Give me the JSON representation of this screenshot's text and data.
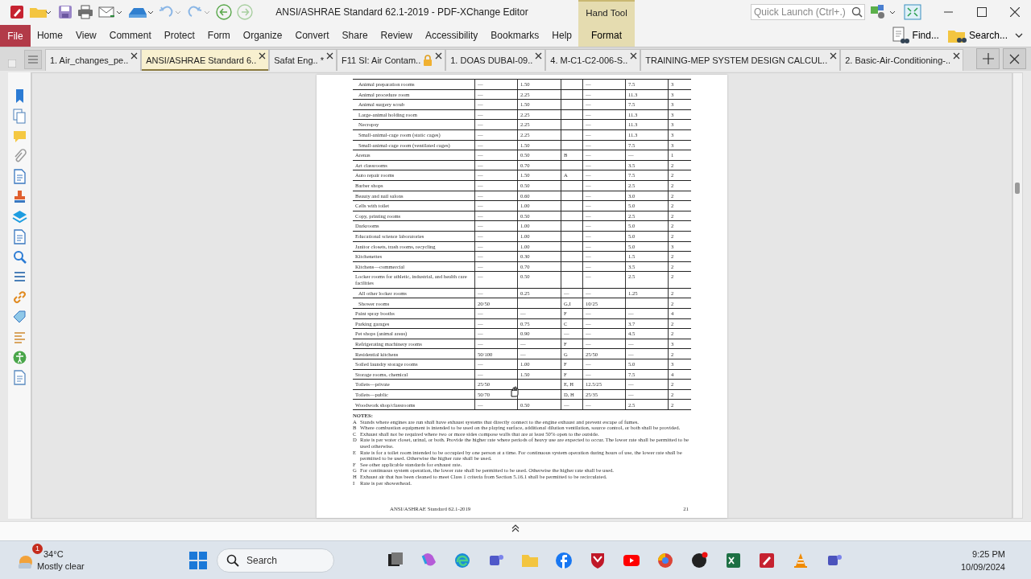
{
  "window": {
    "title": "ANSI/ASHRAE Standard 62.1-2019 - PDF-XChange Editor"
  },
  "quick_launch": {
    "placeholder": "Quick Launch (Ctrl+.)"
  },
  "ribbon": {
    "tabs": [
      {
        "label": "File",
        "kind": "file"
      },
      {
        "label": "Home",
        "kind": "tab"
      },
      {
        "label": "View",
        "kind": "tab"
      },
      {
        "label": "Comment",
        "kind": "tab"
      },
      {
        "label": "Protect",
        "kind": "tab"
      },
      {
        "label": "Form",
        "kind": "tab"
      },
      {
        "label": "Organize",
        "kind": "tab"
      },
      {
        "label": "Convert",
        "kind": "tab"
      },
      {
        "label": "Share",
        "kind": "tab"
      },
      {
        "label": "Review",
        "kind": "tab"
      },
      {
        "label": "Accessibility",
        "kind": "tab"
      },
      {
        "label": "Bookmarks",
        "kind": "tab"
      },
      {
        "label": "Help",
        "kind": "tab"
      }
    ],
    "context_group": {
      "title": "Hand Tool",
      "tabs": [
        "Format"
      ]
    },
    "actions": [
      "Find...",
      "Search..."
    ]
  },
  "doc_tabs": [
    {
      "label": "1. Air_changes_pe..",
      "selected": false,
      "locked": false
    },
    {
      "label": "ANSI/ASHRAE Standard 6..",
      "selected": true,
      "locked": false
    },
    {
      "label": "Safat Eng.. *",
      "selected": false,
      "locked": false
    },
    {
      "label": "F11 SI: Air Contam..",
      "selected": false,
      "locked": true
    },
    {
      "label": "1. DOAS DUBAI-09..",
      "selected": false,
      "locked": false
    },
    {
      "label": "4. M-C1-C2-006-S..",
      "selected": false,
      "locked": false
    },
    {
      "label": "TRAINING-MEP SYSTEM DESIGN CALCUL..",
      "selected": false,
      "locked": false
    },
    {
      "label": "2. Basic-Air-Conditioning-..",
      "selected": false,
      "locked": false
    }
  ],
  "page": {
    "table": {
      "rows": [
        {
          "kind": "sub",
          "column_1": "Animal preparation rooms",
          "column_2": "—",
          "column_3": "1.50",
          "column_5": "—",
          "column_6": "7.5",
          "column_7": "3"
        },
        {
          "kind": "sub",
          "column_1": "Animal procedure room",
          "column_2": "—",
          "column_3": "2.25",
          "column_5": "—",
          "column_6": "11.3",
          "column_7": "3"
        },
        {
          "kind": "sub",
          "column_1": "Animal surgery scrub",
          "column_2": "—",
          "column_3": "1.50",
          "column_5": "—",
          "column_6": "7.5",
          "column_7": "3"
        },
        {
          "kind": "sub",
          "column_1": "Large-animal holding room",
          "column_2": "—",
          "column_3": "2.25",
          "column_5": "—",
          "column_6": "11.3",
          "column_7": "3"
        },
        {
          "kind": "sub",
          "column_1": "Necropsy",
          "column_2": "—",
          "column_3": "2.25",
          "column_5": "—",
          "column_6": "11.3",
          "column_7": "3"
        },
        {
          "kind": "sub",
          "column_1": "Small-animal-cage room (static cages)",
          "column_2": "—",
          "column_3": "2.25",
          "column_5": "—",
          "column_6": "11.3",
          "column_7": "3"
        },
        {
          "kind": "sub",
          "column_1": "Small-animal-cage room (ventilated cages)",
          "column_2": "—",
          "column_3": "1.50",
          "column_5": "—",
          "column_6": "7.5",
          "column_7": "3"
        },
        {
          "kind": "main",
          "column_1": "Arenas",
          "column_2": "—",
          "column_3": "0.50",
          "column_4": "B",
          "column_5": "—",
          "column_6": "—",
          "column_7": "1"
        },
        {
          "kind": "main",
          "column_1": "Art classrooms",
          "column_2": "—",
          "column_3": "0.70",
          "column_5": "—",
          "column_6": "3.5",
          "column_7": "2"
        },
        {
          "kind": "main",
          "column_1": "Auto repair rooms",
          "column_2": "—",
          "column_3": "1.50",
          "column_4": "A",
          "column_5": "—",
          "column_6": "7.5",
          "column_7": "2"
        },
        {
          "kind": "main",
          "column_1": "Barber shops",
          "column_2": "—",
          "column_3": "0.50",
          "column_5": "—",
          "column_6": "2.5",
          "column_7": "2"
        },
        {
          "kind": "main",
          "column_1": "Beauty and nail salons",
          "column_2": "—",
          "column_3": "0.60",
          "column_5": "—",
          "column_6": "3.0",
          "column_7": "2"
        },
        {
          "kind": "main",
          "column_1": "Cells with toilet",
          "column_2": "—",
          "column_3": "1.00",
          "column_5": "—",
          "column_6": "5.0",
          "column_7": "2"
        },
        {
          "kind": "main",
          "column_1": "Copy, printing rooms",
          "column_2": "—",
          "column_3": "0.50",
          "column_5": "—",
          "column_6": "2.5",
          "column_7": "2"
        },
        {
          "kind": "main",
          "column_1": "Darkrooms",
          "column_2": "—",
          "column_3": "1.00",
          "column_5": "—",
          "column_6": "5.0",
          "column_7": "2"
        },
        {
          "kind": "main",
          "column_1": "Educational science laboratories",
          "column_2": "—",
          "column_3": "1.00",
          "column_5": "—",
          "column_6": "5.0",
          "column_7": "2"
        },
        {
          "kind": "main",
          "column_1": "Janitor closets, trash rooms, recycling",
          "column_2": "—",
          "column_3": "1.00",
          "column_5": "—",
          "column_6": "5.0",
          "column_7": "3"
        },
        {
          "kind": "main",
          "column_1": "Kitchenettes",
          "column_2": "—",
          "column_3": "0.30",
          "column_5": "—",
          "column_6": "1.5",
          "column_7": "2"
        },
        {
          "kind": "main",
          "column_1": "Kitchens—commercial",
          "column_2": "—",
          "column_3": "0.70",
          "column_5": "—",
          "column_6": "3.5",
          "column_7": "2"
        },
        {
          "kind": "main",
          "column_1": "Locker rooms for athletic, industrial, and health care facilities",
          "column_2": "—",
          "column_3": "0.50",
          "column_5": "—",
          "column_6": "2.5",
          "column_7": "2"
        },
        {
          "kind": "sub",
          "column_1": "All other locker rooms",
          "column_2": "—",
          "column_3": "0.25",
          "column_4": "—",
          "column_5": "—",
          "column_6": "1.25",
          "column_7": "2"
        },
        {
          "kind": "sub",
          "column_1": "Shower rooms",
          "column_2": "20/50",
          "column_4": "G,I",
          "column_5": "10/25",
          "column_7": "2"
        },
        {
          "kind": "main",
          "column_1": "Paint spray booths",
          "column_2": "—",
          "column_3": "—",
          "column_4": "F",
          "column_5": "—",
          "column_6": "—",
          "column_7": "4"
        },
        {
          "kind": "main",
          "column_1": "Parking garages",
          "column_2": "—",
          "column_3": "0.75",
          "column_4": "C",
          "column_5": "—",
          "column_6": "3.7",
          "column_7": "2"
        },
        {
          "kind": "main",
          "column_1": "Pet shops (animal areas)",
          "column_2": "—",
          "column_3": "0.90",
          "column_4": "—",
          "column_5": "—",
          "column_6": "4.5",
          "column_7": "2"
        },
        {
          "kind": "main",
          "column_1": "Refrigerating machinery rooms",
          "column_2": "—",
          "column_3": "—",
          "column_4": "F",
          "column_5": "—",
          "column_6": "—",
          "column_7": "3"
        },
        {
          "kind": "main",
          "column_1": "Residential kitchens",
          "column_2": "50/100",
          "column_3": "—",
          "column_4": "G",
          "column_5": "25/50",
          "column_6": "—",
          "column_7": "2"
        },
        {
          "kind": "main",
          "column_1": "Soiled laundry storage rooms",
          "column_2": "—",
          "column_3": "1.00",
          "column_4": "F",
          "column_5": "—",
          "column_6": "5.0",
          "column_7": "3"
        },
        {
          "kind": "main",
          "column_1": "Storage rooms, chemical",
          "column_2": "—",
          "column_3": "1.50",
          "column_4": "F",
          "column_5": "—",
          "column_6": "7.5",
          "column_7": "4"
        },
        {
          "kind": "main",
          "column_1": "Toilets—private",
          "column_2": "25/50",
          "column_4": "E, H",
          "column_5": "12.5/25",
          "column_6": "—",
          "column_7": "2"
        },
        {
          "kind": "main",
          "column_1": "Toilets—public",
          "column_2": "50/70",
          "column_4": "D, H",
          "column_5": "25/35",
          "column_6": "—",
          "column_7": "2"
        },
        {
          "kind": "main",
          "column_1": "Woodwork shop/classrooms",
          "column_2": "—",
          "column_3": "0.50",
          "column_4": "—",
          "column_5": "—",
          "column_6": "2.5",
          "column_7": "2"
        }
      ]
    },
    "notes": {
      "heading": "NOTES:",
      "items": [
        {
          "letter": "A",
          "text": "Stands where engines are run shall have exhaust systems that directly connect to the engine exhaust and prevent escape of fumes."
        },
        {
          "letter": "B",
          "text": "Where combustion equipment is intended to be used on the playing surface, additional dilution ventilation, source control, or both shall be provided."
        },
        {
          "letter": "C",
          "text": "Exhaust shall not be required where two or more sides compose walls that are at least 50% open to the outside."
        },
        {
          "letter": "D",
          "text": "Rate is per water closet, urinal, or both. Provide the higher rate where periods of heavy use are expected to occur. The lower rate shall be permitted to be used otherwise."
        },
        {
          "letter": "E",
          "text": "Rate is for a toilet room intended to be occupied by one person at a time. For continuous system operation during hours of use, the lower rate shall be permitted to be used. Otherwise the higher rate shall be used."
        },
        {
          "letter": "F",
          "text": "See other applicable standards for exhaust rate."
        },
        {
          "letter": "G",
          "text": "For continuous system operation, the lower rate shall be permitted to be used. Otherwise the higher rate shall be used."
        },
        {
          "letter": "H",
          "text": "Exhaust air that has been cleaned to meet Class 1 criteria from Section 5.16.1 shall be permitted to be recirculated."
        },
        {
          "letter": "I",
          "text": "Rate is per showerhead."
        }
      ]
    },
    "footer": {
      "title": "ANSI/ASHRAE Standard 62.1-2019",
      "page_number": "21"
    }
  },
  "taskbar": {
    "weather": {
      "temperature": "34°C",
      "condition": "Mostly clear",
      "badge": "1"
    },
    "search": {
      "placeholder": "Search"
    },
    "clock": {
      "time": "9:25 PM",
      "date": "10/09/2024"
    }
  }
}
